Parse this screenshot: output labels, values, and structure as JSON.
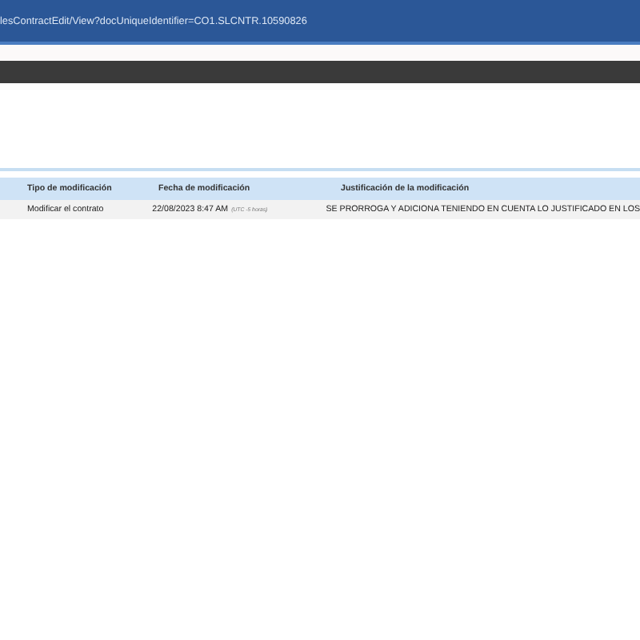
{
  "address_bar": {
    "url": "lesContractEdit/View?docUniqueIdentifier=CO1.SLCNTR.10590826"
  },
  "table": {
    "columns": [
      "Tipo de modificación",
      "Fecha de modificación",
      "Justificación de la modificación"
    ],
    "rows": [
      {
        "type": "Modificar el contrato",
        "date": "22/08/2023 8:47 AM",
        "timezone": "(UTC -5 horas)",
        "justification": "SE PRORROGA Y ADICIONA TENIENDO EN CUENTA LO JUSTIFICADO EN LOS"
      }
    ]
  }
}
